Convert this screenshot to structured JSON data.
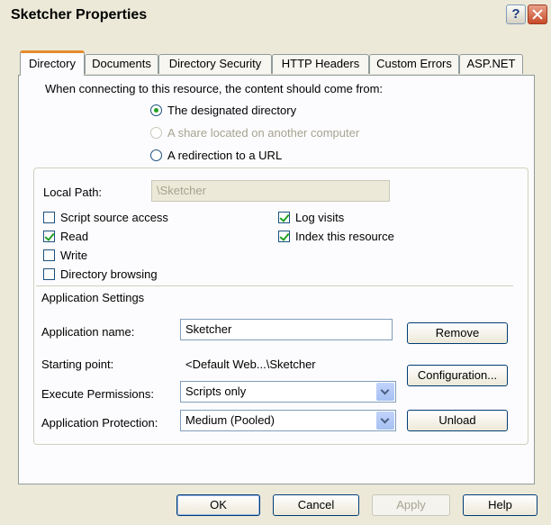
{
  "window": {
    "title": "Sketcher Properties"
  },
  "tabs": [
    {
      "label": "Directory"
    },
    {
      "label": "Documents"
    },
    {
      "label": "Directory Security"
    },
    {
      "label": "HTTP Headers"
    },
    {
      "label": "Custom Errors"
    },
    {
      "label": "ASP.NET"
    }
  ],
  "content_source": {
    "prompt": "When connecting to this resource, the content should come from:",
    "options": [
      {
        "label": "The designated directory",
        "selected": true,
        "enabled": true
      },
      {
        "label": "A share located on another computer",
        "selected": false,
        "enabled": false
      },
      {
        "label": "A redirection to a URL",
        "selected": false,
        "enabled": true
      }
    ]
  },
  "local_path": {
    "label": "Local Path:",
    "value": "\\Sketcher"
  },
  "permissions": [
    {
      "label": "Script source access",
      "checked": false
    },
    {
      "label": "Read",
      "checked": true
    },
    {
      "label": "Write",
      "checked": false
    },
    {
      "label": "Directory browsing",
      "checked": false
    },
    {
      "label": "Log visits",
      "checked": true
    },
    {
      "label": "Index this resource",
      "checked": true
    }
  ],
  "app_settings": {
    "heading": "Application Settings",
    "name_label": "Application name:",
    "name_value": "Sketcher",
    "remove_label": "Remove",
    "starting_label": "Starting point:",
    "starting_value": "<Default Web...\\Sketcher",
    "config_label": "Configuration...",
    "exec_label": "Execute Permissions:",
    "exec_value": "Scripts only",
    "protection_label": "Application Protection:",
    "protection_value": "Medium (Pooled)",
    "unload_label": "Unload"
  },
  "footer": {
    "ok": "OK",
    "cancel": "Cancel",
    "apply": "Apply",
    "help": "Help"
  }
}
